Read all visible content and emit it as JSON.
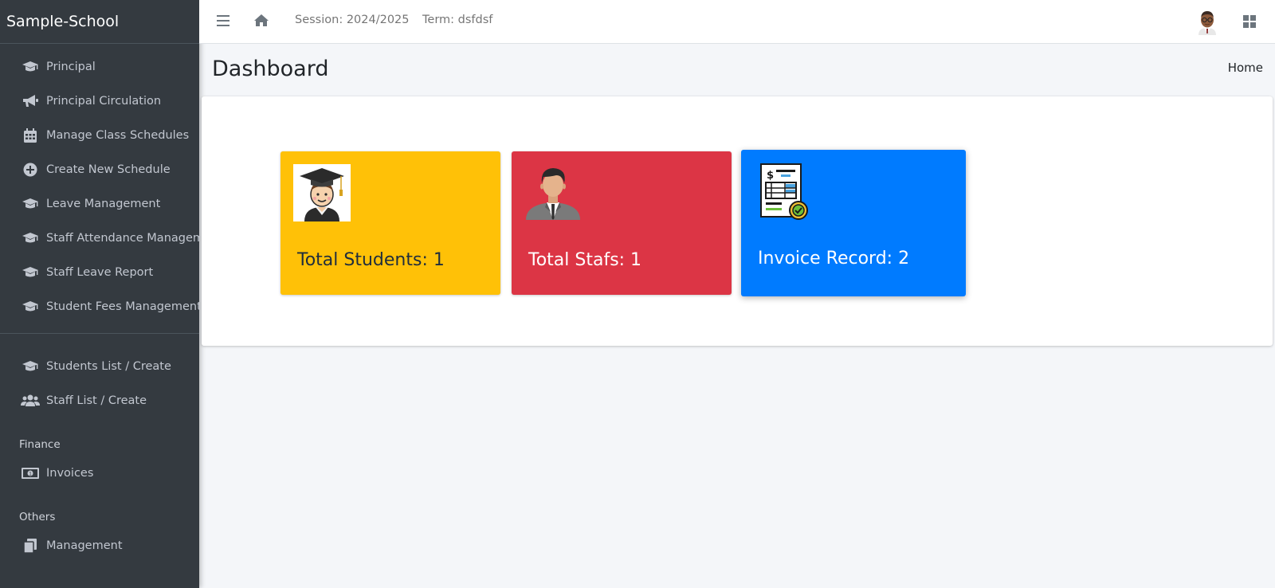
{
  "brand": {
    "title": "Sample-School"
  },
  "sidebar": {
    "items": [
      {
        "label": "Principal",
        "icon": "graduation-cap-icon"
      },
      {
        "label": "Principal Circulation",
        "icon": "bullhorn-icon"
      },
      {
        "label": "Manage Class Schedules",
        "icon": "calendar-icon"
      },
      {
        "label": "Create New Schedule",
        "icon": "plus-circle-icon"
      },
      {
        "label": "Leave Management",
        "icon": "graduation-cap-icon"
      },
      {
        "label": "Staff Attendance Manageme",
        "icon": "graduation-cap-icon"
      },
      {
        "label": "Staff Leave Report",
        "icon": "graduation-cap-icon"
      },
      {
        "label": "Student Fees Management",
        "icon": "graduation-cap-icon"
      }
    ],
    "people_items": [
      {
        "label": "Students List / Create",
        "icon": "graduation-cap-icon"
      },
      {
        "label": "Staff List / Create",
        "icon": "users-icon"
      }
    ],
    "finance_header": "Finance",
    "finance_items": [
      {
        "label": "Invoices",
        "icon": "money-bill-icon"
      }
    ],
    "others_header": "Others",
    "others_items": [
      {
        "label": "Management",
        "icon": "copy-icon"
      }
    ]
  },
  "navbar": {
    "session": "Session: 2024/2025",
    "term": "Term: dsfdsf"
  },
  "header": {
    "title": "Dashboard",
    "breadcrumb": "Home"
  },
  "stats": {
    "students": {
      "label": "Total Students: 1",
      "icon": "graduate-student-icon",
      "color": "#ffc107"
    },
    "staffs": {
      "label": "Total Stafs: 1",
      "icon": "staff-person-icon",
      "color": "#dc3545"
    },
    "invoices": {
      "label": "Invoice Record: 2",
      "icon": "invoice-document-icon",
      "color": "#007bff"
    }
  },
  "colors": {
    "sidebar_bg": "#343a40",
    "content_bg": "#f4f6f9"
  }
}
